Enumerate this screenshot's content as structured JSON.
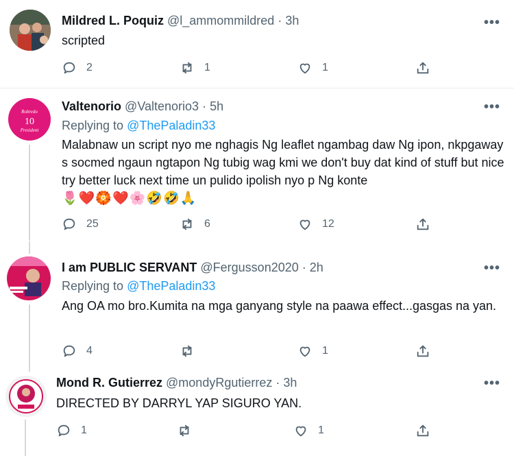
{
  "tweets": [
    {
      "name": "Mildred L. Poquiz",
      "handle": "@l_ammommildred",
      "time": "3h",
      "text": "scripted",
      "replies": "2",
      "retweets": "1",
      "likes": "1"
    },
    {
      "name": "Valtenorio",
      "handle": "@Valtenorio3",
      "time": "5h",
      "replying_prefix": "Replying to",
      "replying_to": "@ThePaladin33",
      "text": "Malabnaw un script nyo me nghagis Ng leaflet ngambag daw Ng ipon, nkpgaway s socmed ngaun ngtapon Ng tubig wag kmi we don't buy dat kind of stuff but nice try better luck next time un pulido ipolish nyo p Ng konte",
      "emojis": "🌷❤️🏵️❤️🌸🤣🤣🙏",
      "avatar_text": [
        "Robredo",
        "10",
        "President"
      ],
      "replies": "25",
      "retweets": "6",
      "likes": "12"
    },
    {
      "name": "I am PUBLIC SERVANT",
      "handle": "@Fergusson2020",
      "time": "2h",
      "replying_prefix": "Replying to",
      "replying_to": "@ThePaladin33",
      "text": "Ang OA mo bro.Kumita na mga ganyang style na paawa effect...gasgas na yan.",
      "replies": "4",
      "retweets": "",
      "likes": "1"
    },
    {
      "name": "Mond R. Gutierrez",
      "handle": "@mondyRgutierrez",
      "time": "3h",
      "text": "DIRECTED BY DARRYL YAP SIGURO YAN.",
      "replies": "1",
      "retweets": "",
      "likes": "1"
    }
  ],
  "separator": "·",
  "more_label": "•••",
  "colors": {
    "link": "#1d9bf0",
    "muted": "#536471",
    "avatar2_bg": "#e0177a"
  },
  "icons": [
    "reply-icon",
    "retweet-icon",
    "like-icon",
    "share-icon",
    "more-icon"
  ]
}
